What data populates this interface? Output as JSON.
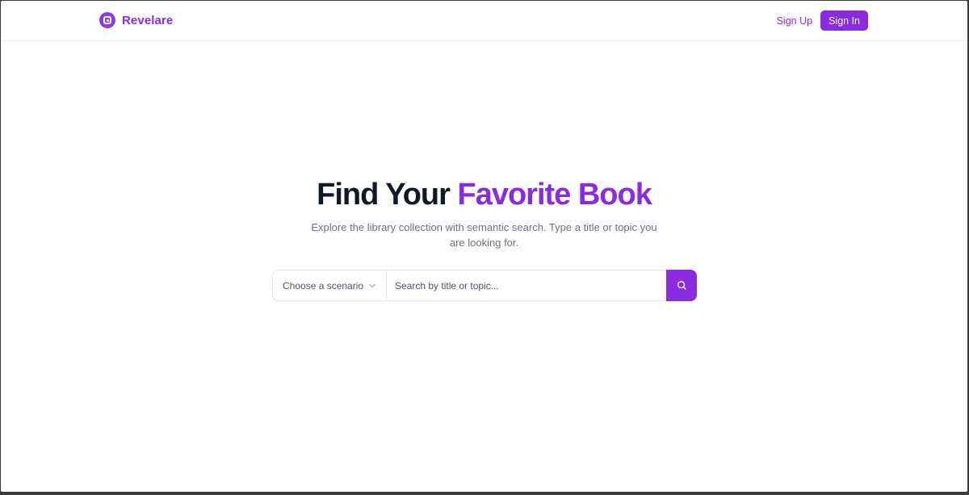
{
  "brand": {
    "name": "Revelare",
    "icon": "revelare-logo-icon"
  },
  "nav": {
    "signup_label": "Sign Up",
    "signin_label": "Sign In"
  },
  "hero": {
    "title_main": "Find Your ",
    "title_accent": "Favorite Book",
    "subtitle": "Explore the library collection with semantic search. Type a title or topic you are looking for."
  },
  "search": {
    "scenario_placeholder": "Choose a scenario",
    "input_placeholder": "Search by title or topic...",
    "input_value": "",
    "button_icon": "search-icon"
  },
  "colors": {
    "accent": "#8a2be2",
    "title": "#111827",
    "muted_text": "#6b7280"
  }
}
